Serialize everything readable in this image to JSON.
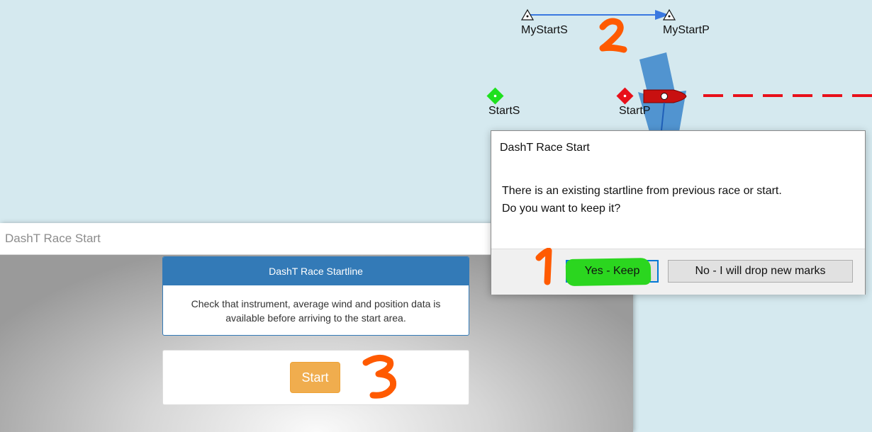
{
  "map": {
    "marks": [
      {
        "id": "mystarts",
        "label": "MyStartS"
      },
      {
        "id": "mystartp",
        "label": "MyStartP"
      },
      {
        "id": "starts",
        "label": "StartS"
      },
      {
        "id": "startp",
        "label": "StartP"
      }
    ],
    "colors": {
      "background": "#d5e9ef",
      "start_s_mark": "#1ee01e",
      "start_p_mark": "#e8101a",
      "route_line": "#e8101a",
      "myline_arrow": "#3a78e0",
      "wind_arrow": "#4a8fcd",
      "boat": "#c81010"
    }
  },
  "plugin_window": {
    "title": "DashT Race Start",
    "panel_heading": "DashT Race Startline",
    "panel_text_line1": "Check that instrument, average wind and position data is",
    "panel_text_line2": "available before arriving to the start area.",
    "start_button": "Start"
  },
  "dialog": {
    "title": "DashT Race Start",
    "message_line1": "There is an existing startline from previous race or start.",
    "message_line2": "Do you want to keep it?",
    "yes_button": "Yes - Keep",
    "no_button": "No - I will drop new marks"
  },
  "annotations": {
    "color": "#ff5a00",
    "steps": [
      "1",
      "2",
      "3"
    ]
  }
}
